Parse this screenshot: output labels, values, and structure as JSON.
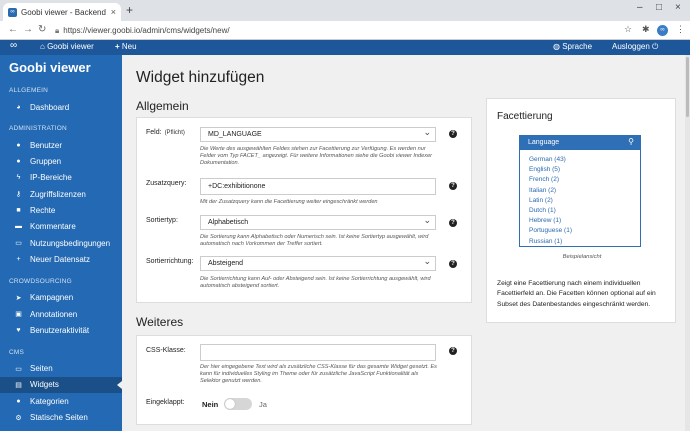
{
  "browser": {
    "tab_title": "Goobi viewer - Backend",
    "url": "https://viewer.goobi.io/admin/cms/widgets/new/"
  },
  "topnav": {
    "brand": "Goobi viewer",
    "new": "Neu",
    "language": "Sprache",
    "logout": "Ausloggen"
  },
  "sidebar": {
    "brand": "Goobi viewer",
    "sections": [
      {
        "title": "ALLGEMEIN",
        "items": [
          {
            "label": "Dashboard",
            "icon": "dashboard-icon",
            "glyph": "◕"
          }
        ]
      },
      {
        "title": "ADMINISTRATION",
        "items": [
          {
            "label": "Benutzer",
            "icon": "user-icon",
            "glyph": "●"
          },
          {
            "label": "Gruppen",
            "icon": "users-icon",
            "glyph": "●"
          },
          {
            "label": "IP-Bereiche",
            "icon": "ip-icon",
            "glyph": "ϟ"
          },
          {
            "label": "Zugriffslizenzen",
            "icon": "key-icon",
            "glyph": "⚷"
          },
          {
            "label": "Rechte",
            "icon": "lock-icon",
            "glyph": "■"
          },
          {
            "label": "Kommentare",
            "icon": "comment-icon",
            "glyph": "▬"
          },
          {
            "label": "Nutzungsbedingungen",
            "icon": "terms-icon",
            "glyph": "▭"
          },
          {
            "label": "Neuer Datensatz",
            "icon": "plus-icon",
            "glyph": "+"
          }
        ]
      },
      {
        "title": "CROWDSOURCING",
        "items": [
          {
            "label": "Kampagnen",
            "icon": "campaign-icon",
            "glyph": "➤"
          },
          {
            "label": "Annotationen",
            "icon": "annotation-icon",
            "glyph": "▣"
          },
          {
            "label": "Benutzeraktivität",
            "icon": "activity-icon",
            "glyph": "♥"
          }
        ]
      },
      {
        "title": "CMS",
        "items": [
          {
            "label": "Seiten",
            "icon": "pages-icon",
            "glyph": "▭"
          },
          {
            "label": "Widgets",
            "icon": "widgets-icon",
            "glyph": "▤",
            "active": true
          },
          {
            "label": "Kategorien",
            "icon": "category-icon",
            "glyph": "●"
          },
          {
            "label": "Statische Seiten",
            "icon": "static-pages-icon",
            "glyph": "⚙"
          }
        ]
      }
    ]
  },
  "page": {
    "title": "Widget hinzufügen"
  },
  "allgemein": {
    "heading": "Allgemein",
    "field": {
      "label": "Feld:",
      "required": "(Pflicht)",
      "value": "MD_LANGUAGE",
      "help": "Die Werte des ausgewählten Feldes stehen zur Facettierung zur Verfügung. Es werden nur Felder vom Typ FACET_ angezeigt. Für weitere Informationen siehe die Goobi viewer Indexer Dokumentation."
    },
    "query": {
      "label": "Zusatzquery:",
      "value": "+DC:exhibitionone",
      "help": "Mit der Zusatzquery kann die Facettierung weiter eingeschränkt werden"
    },
    "sorttype": {
      "label": "Sortiertyp:",
      "value": "Alphabetisch",
      "help": "Die Sortierung kann Alphabetisch oder Numerisch sein. Ist keine Sortiertyp ausgewählt, wird automatisch nach Vorkommen der Treffer sortiert."
    },
    "sortdir": {
      "label": "Sortierrichtung:",
      "value": "Absteigend",
      "help": "Die Sortierrichtung kann Auf- oder Absteigend sein. Ist keine Sortierrichtung ausgewählt, wird automatisch absteigend sortiert."
    }
  },
  "weiteres": {
    "heading": "Weiteres",
    "css": {
      "label": "CSS-Klasse:",
      "value": "",
      "help": "Der hier eingegebene Text wird als zusätzliche CSS-Klasse für das gesamte Widget gesetzt. Es kann für individuelles Styling im Theme oder für zusätzliche JavaScript Funktionalität als Selektor genutzt werden."
    },
    "collapsed": {
      "label": "Eingeklappt:",
      "no": "Nein",
      "yes": "Ja",
      "value": false
    }
  },
  "facet_preview": {
    "title": "Facettierung",
    "box_title": "Language",
    "items": [
      "German (43)",
      "English (5)",
      "French (2)",
      "Italian (2)",
      "Latin (2)",
      "Dutch (1)",
      "Hebrew (1)",
      "Portuguese (1)",
      "Russian (1)"
    ],
    "caption": "Beispielansicht",
    "description": "Zeigt eine Facettierung nach einem individuellen Facettierfeld an. Die Facetten können optional auf ein Subset des Datenbestandes eingeschränkt werden."
  }
}
